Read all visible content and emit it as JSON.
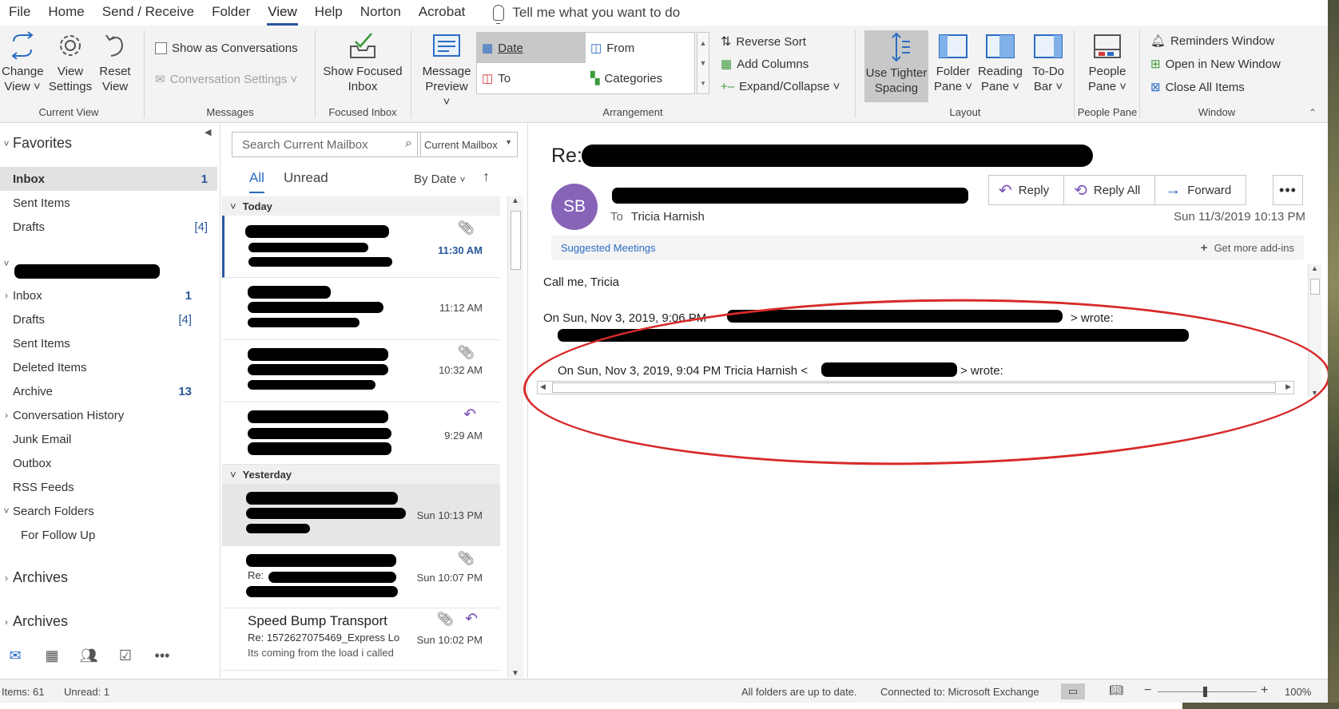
{
  "menu": {
    "items": [
      "File",
      "Home",
      "Send / Receive",
      "Folder",
      "View",
      "Help",
      "Norton",
      "Acrobat"
    ],
    "active": "View",
    "tell_me": "Tell me what you want to do"
  },
  "ribbon": {
    "current_view": {
      "group_label": "Current View",
      "change_view": [
        "Change",
        "View ˅"
      ],
      "view_settings": [
        "View",
        "Settings"
      ],
      "reset_view": [
        "Reset",
        "View"
      ]
    },
    "messages": {
      "group_label": "Messages",
      "show_as_conversations": "Show as Conversations",
      "conversation_settings": "Conversation Settings ˅"
    },
    "focused_inbox": {
      "group_label": "Focused Inbox",
      "show_focused_inbox": [
        "Show Focused",
        "Inbox"
      ]
    },
    "arrangement": {
      "group_label": "Arrangement",
      "message_preview": [
        "Message",
        "Preview ˅"
      ],
      "gallery": [
        "Date",
        "From",
        "To",
        "Categories"
      ],
      "selected": "Date",
      "reverse_sort": "Reverse Sort",
      "add_columns": "Add Columns",
      "expand_collapse": "Expand/Collapse ˅"
    },
    "layout": {
      "group_label": "Layout",
      "tighter_spacing": [
        "Use Tighter",
        "Spacing"
      ],
      "folder_pane": [
        "Folder",
        "Pane ˅"
      ],
      "reading_pane": [
        "Reading",
        "Pane ˅"
      ],
      "todo_bar": [
        "To-Do",
        "Bar ˅"
      ]
    },
    "people_pane": {
      "group_label": "People Pane",
      "people_pane": [
        "People",
        "Pane ˅"
      ]
    },
    "window": {
      "group_label": "Window",
      "reminders": "Reminders Window",
      "open_new": "Open in New Window",
      "close_all": "Close All Items"
    }
  },
  "nav": {
    "favorites_label": "Favorites",
    "favorites": [
      {
        "label": "Inbox",
        "count": "1"
      },
      {
        "label": "Sent Items",
        "count": ""
      },
      {
        "label": "Drafts",
        "count": "[4]"
      }
    ],
    "account_folders": [
      {
        "label": "Inbox",
        "count": "1",
        "chevron": "›"
      },
      {
        "label": "Drafts",
        "count": "[4]",
        "chevron": ""
      },
      {
        "label": "Sent Items",
        "count": "",
        "chevron": ""
      },
      {
        "label": "Deleted Items",
        "count": "",
        "chevron": ""
      },
      {
        "label": "Archive",
        "count": "13",
        "chevron": ""
      },
      {
        "label": "Conversation History",
        "count": "",
        "chevron": "›"
      },
      {
        "label": "Junk Email",
        "count": "",
        "chevron": ""
      },
      {
        "label": "Outbox",
        "count": "",
        "chevron": ""
      },
      {
        "label": "RSS Feeds",
        "count": "",
        "chevron": ""
      },
      {
        "label": "Search Folders",
        "count": "",
        "chevron": "˅"
      },
      {
        "label": "For Follow Up",
        "count": "",
        "chevron": ""
      }
    ],
    "archives_1": "Archives",
    "archives_2": "Archives"
  },
  "list": {
    "search_placeholder": "Search Current Mailbox",
    "scope": "Current Mailbox",
    "tab_all": "All",
    "tab_unread": "Unread",
    "sort_label": "By Date",
    "group_today": "Today",
    "group_yesterday": "Yesterday",
    "times": [
      "11:30 AM",
      "11:12 AM",
      "10:32 AM",
      "9:29 AM",
      "Sun 10:13 PM",
      "Sun 10:07 PM",
      "Sun 10:02 PM"
    ],
    "partial_subject_6": "Re:",
    "last_mail": {
      "sender": "Speed Bump Transport",
      "subject": "Re: 1572627075469_Express Lo...",
      "preview": "Its coming from the load i called"
    }
  },
  "reading": {
    "subject_prefix": "Re:",
    "avatar_initials": "SB",
    "to_label": "To",
    "to_name": "Tricia Harnish",
    "datetime": "Sun 11/3/2019 10:13 PM",
    "actions": {
      "reply": "Reply",
      "reply_all": "Reply All",
      "forward": "Forward"
    },
    "suggested_meetings": "Suggested Meetings",
    "get_addins": "Get more add-ins",
    "body_line1": "Call me, Tricia",
    "quote1_prefix": "On Sun, Nov 3, 2019, 9:06 PM",
    "quote1_suffix": "> wrote:",
    "quote2_prefix": "On Sun, Nov 3, 2019, 9:04 PM Tricia Harnish <",
    "quote2_suffix": "> wrote:"
  },
  "status": {
    "items": "Items: 61",
    "unread": "Unread: 1",
    "sync": "All folders are up to date.",
    "connection": "Connected to: Microsoft Exchange",
    "zoom": "100%"
  },
  "colors": {
    "accent": "#2b579a",
    "avatar": "#8764b8",
    "annotation": "#d72a2a"
  }
}
